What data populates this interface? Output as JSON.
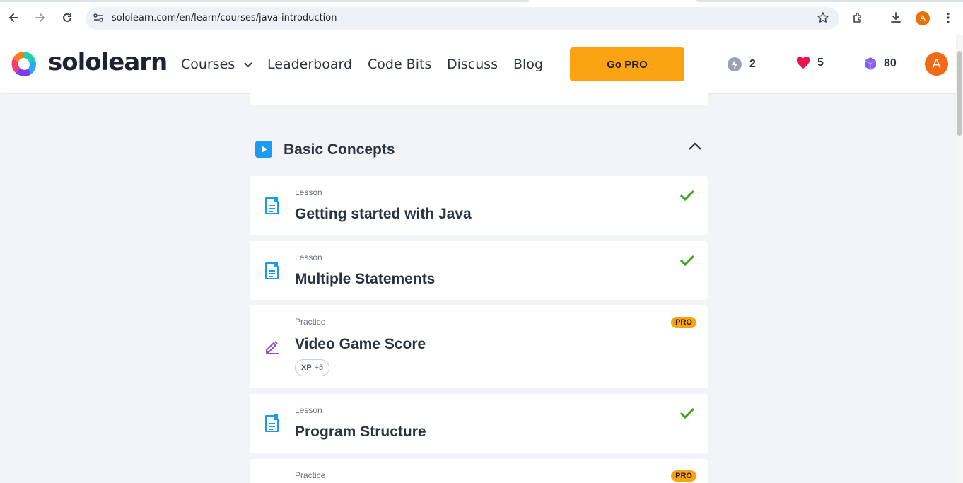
{
  "browser": {
    "url": "sololearn.com/en/learn/courses/java-introduction",
    "profile_initial": "A"
  },
  "header": {
    "logo_text": "sololearn",
    "nav": [
      "Courses",
      "Leaderboard",
      "Code Bits",
      "Discuss",
      "Blog"
    ],
    "gopro_label": "Go PRO",
    "streak": "2",
    "hearts": "5",
    "gems": "80",
    "avatar_initial": "A"
  },
  "module": {
    "title": "Basic Concepts",
    "items": [
      {
        "kind": "Lesson",
        "name": "Getting started with Java",
        "completed": true
      },
      {
        "kind": "Lesson",
        "name": "Multiple Statements",
        "completed": true
      },
      {
        "kind": "Practice",
        "name": "Video Game Score",
        "pro": "PRO",
        "xp_label": "XP",
        "xp_value": "+5"
      },
      {
        "kind": "Lesson",
        "name": "Program Structure",
        "completed": true
      },
      {
        "kind": "Practice",
        "pro": "PRO"
      }
    ]
  },
  "colors": {
    "accent_orange": "#fca311",
    "check_green": "#3aa617",
    "lesson_blue": "#1a9bf0",
    "practice_purple": "#8a4fd1",
    "heart": "#e8144c",
    "gem": "#8b5cf6"
  },
  "icons": {
    "lesson": "lesson-document-icon",
    "practice": "practice-pencil-icon",
    "completed": "checkmark-icon"
  }
}
